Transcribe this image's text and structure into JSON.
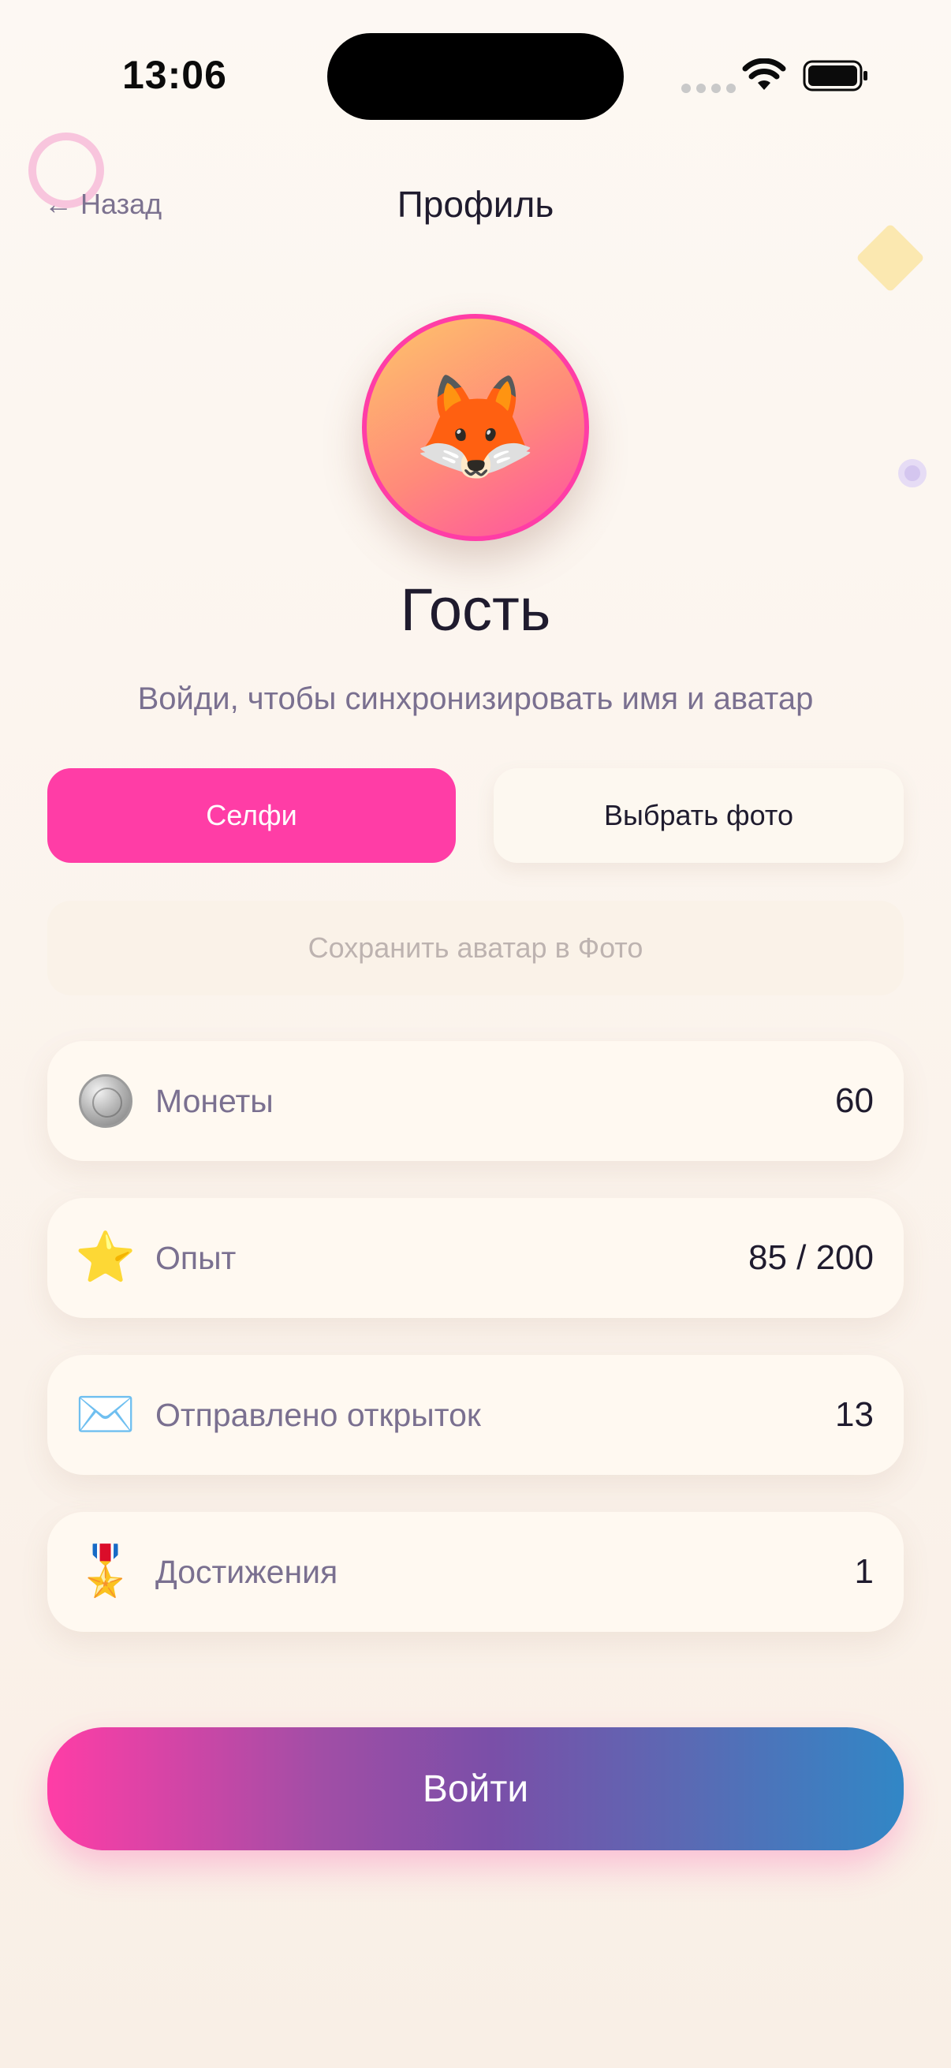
{
  "status_bar": {
    "time": "13:06"
  },
  "nav": {
    "back_label": "← Назад",
    "title": "Профиль"
  },
  "profile": {
    "avatar_emoji": "🦊",
    "name": "Гость",
    "subtitle": "Войди, чтобы синхронизировать имя и аватар"
  },
  "actions": {
    "selfie_label": "Селфи",
    "choose_photo_label": "Выбрать фото",
    "save_avatar_label": "Сохранить аватар в Фото"
  },
  "stats": [
    {
      "icon": "coin-icon",
      "label": "Монеты",
      "value": "60"
    },
    {
      "icon": "star-icon",
      "glyph": "⭐",
      "label": "Опыт",
      "value": "85 / 200"
    },
    {
      "icon": "envelope-icon",
      "glyph": "✉️",
      "label": "Отправлено открыток",
      "value": "13"
    },
    {
      "icon": "medal-icon",
      "glyph": "🎖️",
      "label": "Достижения",
      "value": "1"
    }
  ],
  "login": {
    "label": "Войти"
  },
  "colors": {
    "accent_pink": "#ff3da6",
    "gradient_end_blue": "#3187c6",
    "background": "#fdf8f3",
    "text_primary": "#1f1b2e",
    "text_secondary": "#7a7090"
  }
}
